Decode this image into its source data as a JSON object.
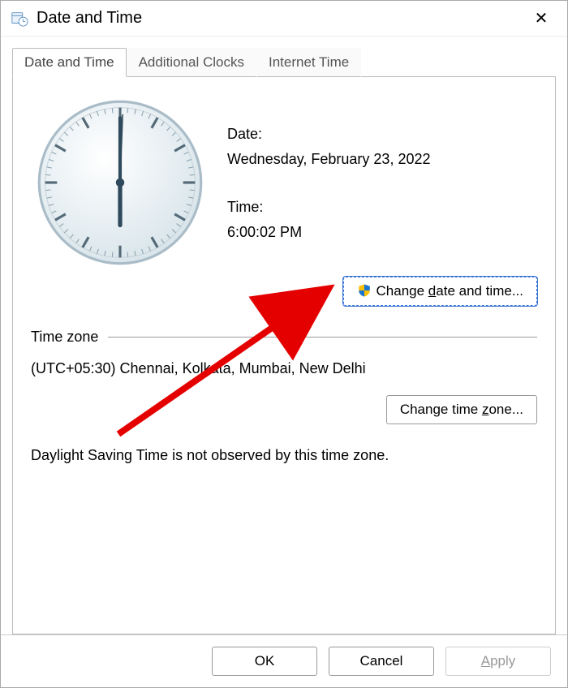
{
  "window": {
    "title": "Date and Time"
  },
  "tabs": [
    {
      "label": "Date and Time"
    },
    {
      "label": "Additional Clocks"
    },
    {
      "label": "Internet Time"
    }
  ],
  "labels": {
    "date": "Date:",
    "time": "Time:"
  },
  "values": {
    "date": "Wednesday, February 23, 2022",
    "time": "6:00:02 PM"
  },
  "buttons": {
    "change_dt_pre": "Change ",
    "change_dt_u": "d",
    "change_dt_post": "ate and time...",
    "change_tz_pre": "Change time ",
    "change_tz_u": "z",
    "change_tz_post": "one...",
    "ok": "OK",
    "cancel": "Cancel",
    "apply_u": "A",
    "apply_post": "pply"
  },
  "section": {
    "timezone_label": "Time zone"
  },
  "timezone": "(UTC+05:30) Chennai, Kolkata, Mumbai, New Delhi",
  "dst_note": "Daylight Saving Time is not observed by this time zone."
}
